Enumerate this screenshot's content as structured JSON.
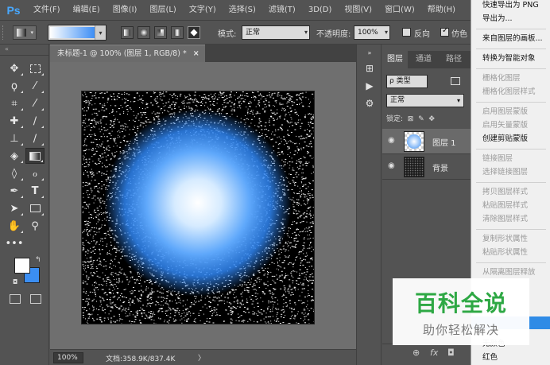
{
  "app": {
    "logo": "Ps"
  },
  "menubar": {
    "items": [
      "文件(F)",
      "编辑(E)",
      "图像(I)",
      "图层(L)",
      "文字(Y)",
      "选择(S)",
      "滤镜(T)",
      "3D(D)",
      "视图(V)",
      "窗口(W)",
      "帮助(H)"
    ]
  },
  "options": {
    "mode_label": "模式:",
    "mode_value": "正常",
    "opacity_label": "不透明度:",
    "opacity_value": "100%",
    "reverse_label": "反向",
    "dither_label": "仿色",
    "gradient_colors": [
      "#ffffff",
      "#3d8ef5"
    ]
  },
  "colors": {
    "foreground": "#ffffff",
    "background": "#3b8ef2"
  },
  "document": {
    "tab_title": "未标题-1 @ 100% (图层 1, RGB/8) *",
    "close_glyph": "×",
    "zoom": "100%",
    "doc_info": "文档:358.9K/837.4K",
    "status_arrow": "〉"
  },
  "layers_panel": {
    "tabs": [
      "图层",
      "通道",
      "路径"
    ],
    "filter_value": "ρ 类型",
    "blend_mode": "正常",
    "lock_label": "锁定:",
    "layers": [
      {
        "name": "图层 1",
        "selected": true
      },
      {
        "name": "背景",
        "selected": false
      }
    ],
    "footer": [
      "⊕",
      "fx",
      "◘"
    ]
  },
  "context_menu": {
    "items": [
      {
        "label": "快速导出为 PNG",
        "enabled": true
      },
      {
        "label": "导出为...",
        "enabled": true
      },
      {
        "label": "来自图层的画板...",
        "enabled": true
      },
      {
        "label": "转换为智能对象",
        "enabled": true
      },
      {
        "label": "栅格化图层",
        "enabled": false
      },
      {
        "label": "栅格化图层样式",
        "enabled": false
      },
      {
        "label": "启用图层蒙版",
        "enabled": false
      },
      {
        "label": "启用矢量蒙版",
        "enabled": false
      },
      {
        "label": "创建剪贴蒙版",
        "enabled": true
      },
      {
        "label": "链接图层",
        "enabled": false
      },
      {
        "label": "选择链接图层",
        "enabled": false
      },
      {
        "label": "拷贝图层样式",
        "enabled": false
      },
      {
        "label": "粘贴图层样式",
        "enabled": false
      },
      {
        "label": "清除图层样式",
        "enabled": false
      },
      {
        "label": "复制形状属性",
        "enabled": false
      },
      {
        "label": "粘贴形状属性",
        "enabled": false
      },
      {
        "label": "从隔离图层释放",
        "enabled": false
      },
      {
        "label": "无颜色",
        "enabled": true
      },
      {
        "label": "红色",
        "enabled": true
      }
    ]
  },
  "watermark": {
    "title": "百科全说",
    "subtitle": "助你轻松解决"
  }
}
